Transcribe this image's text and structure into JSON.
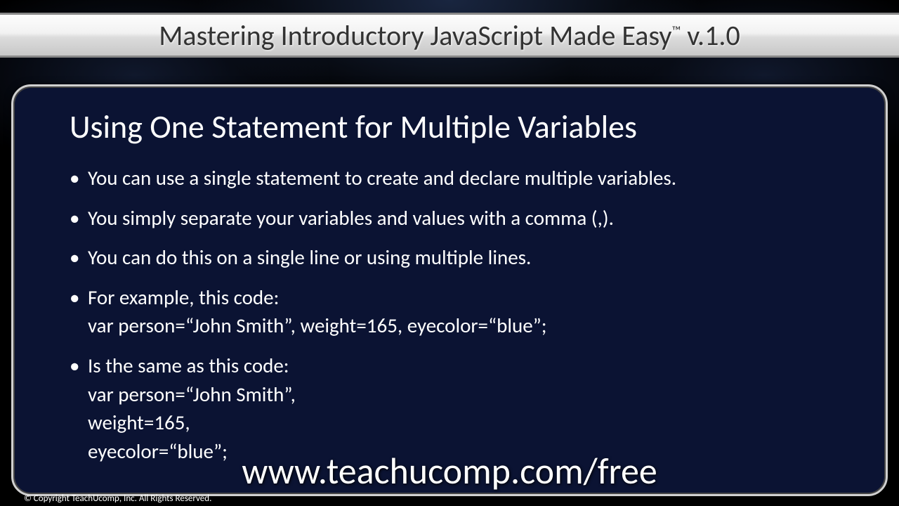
{
  "titlebar": {
    "title_pre": "Mastering Introductory JavaScript Made Easy",
    "tm": "™",
    "title_suffix": " v.1.0"
  },
  "slide": {
    "heading": "Using One Statement for Multiple Variables",
    "bullets": [
      "You can use a single statement to create and declare multiple variables.",
      "You simply separate your variables and values with a comma (,).",
      "You can do this on a single line or using multiple lines.",
      "For example, this code:\nvar person=“John Smith”, weight=165, eyecolor=“blue”;",
      "Is the same as this code:\nvar person=“John Smith”,\nweight=165,\neyecolor=“blue”;"
    ]
  },
  "overlay_url": "www.teachucomp.com/free",
  "copyright": "© Copyright TeachUcomp, Inc. All Rights Reserved."
}
